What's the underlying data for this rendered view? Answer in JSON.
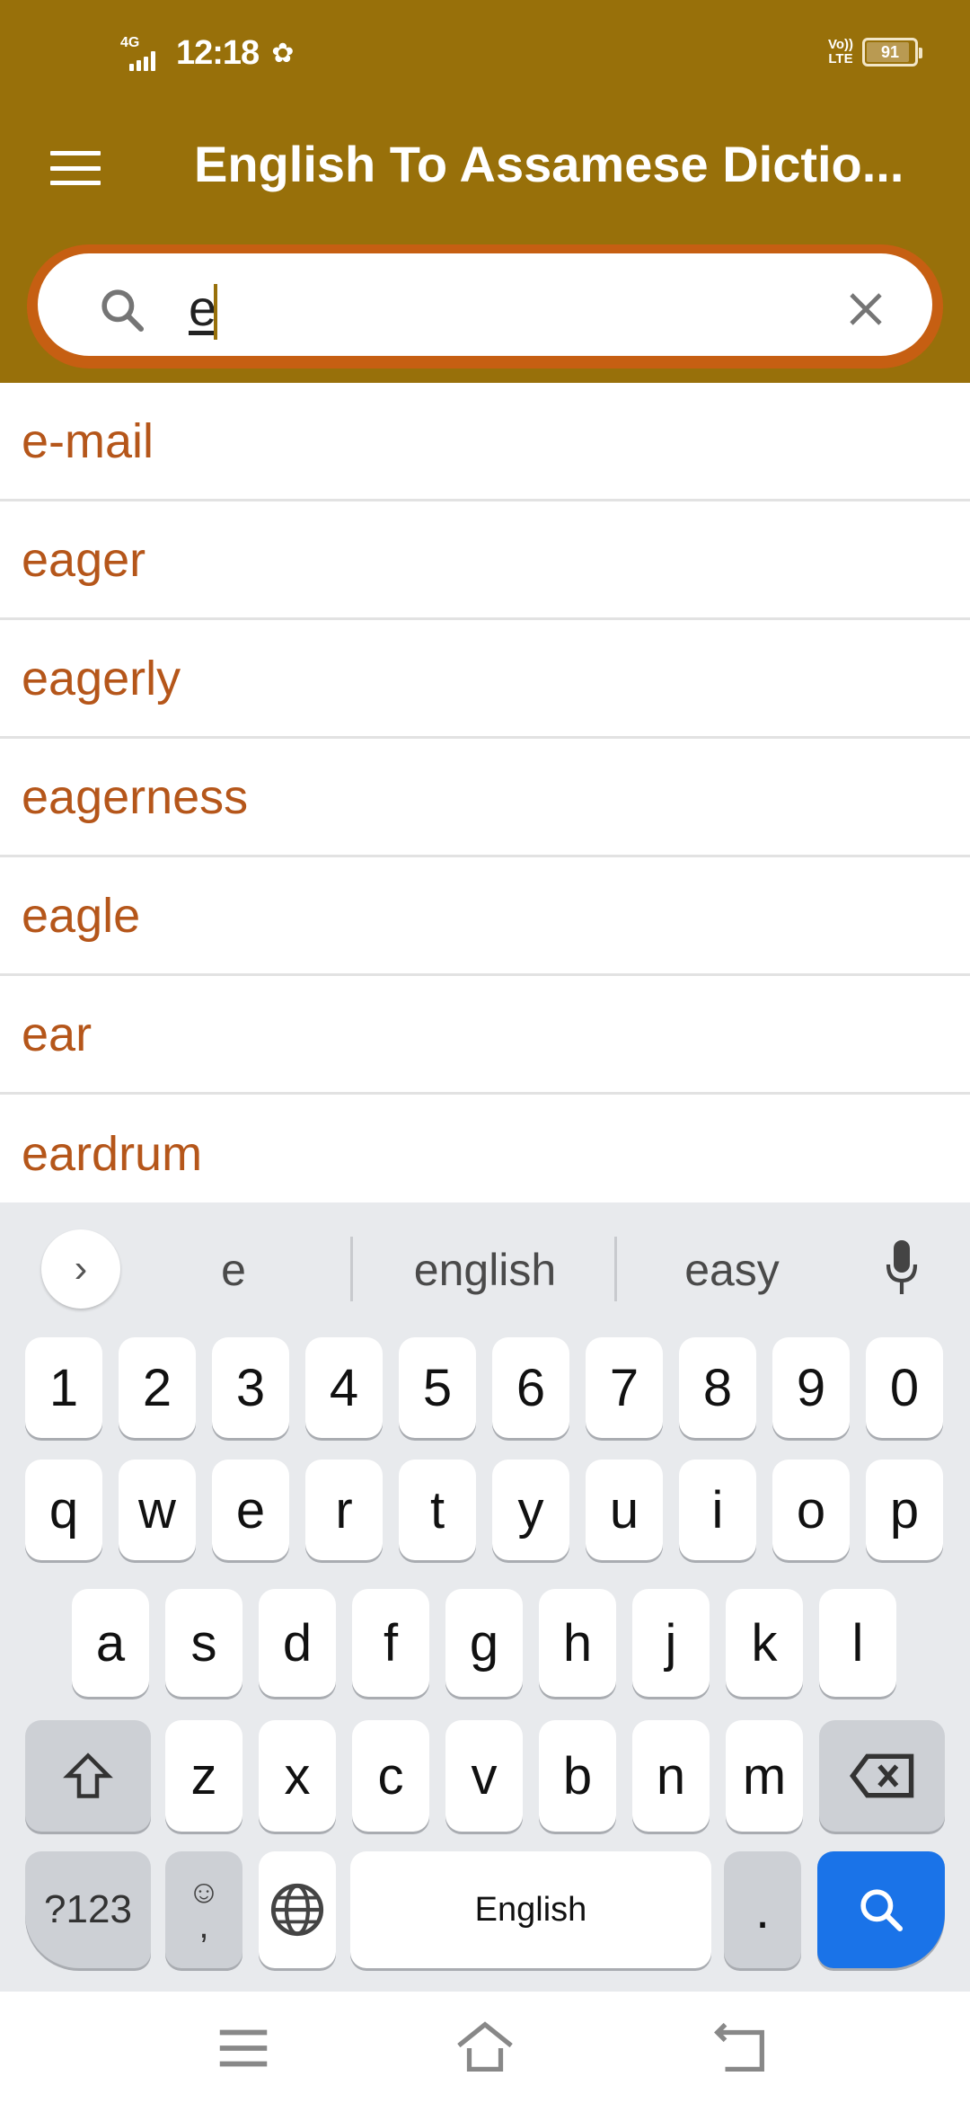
{
  "status_bar": {
    "network": "4G",
    "time": "12:18",
    "volte": [
      "Vo))",
      "LTE"
    ],
    "battery_percent": 91,
    "icons": [
      "signal-icon",
      "settings-gear-icon",
      "volte-icon",
      "battery-icon"
    ]
  },
  "app_bar": {
    "title": "English To Assamese Dictio...",
    "menu_icon": "hamburger-menu-icon"
  },
  "search": {
    "value": "e",
    "search_icon": "search-icon",
    "clear_icon": "close-icon"
  },
  "results": [
    {
      "word": "e-mail"
    },
    {
      "word": "eager"
    },
    {
      "word": "eagerly"
    },
    {
      "word": "eagerness"
    },
    {
      "word": "eagle"
    },
    {
      "word": "ear"
    },
    {
      "word": "eardrum"
    }
  ],
  "keyboard": {
    "suggestions": [
      "e",
      "english",
      "easy"
    ],
    "number_row": [
      "1",
      "2",
      "3",
      "4",
      "5",
      "6",
      "7",
      "8",
      "9",
      "0"
    ],
    "row1": [
      "q",
      "w",
      "e",
      "r",
      "t",
      "y",
      "u",
      "i",
      "o",
      "p"
    ],
    "row2": [
      "a",
      "s",
      "d",
      "f",
      "g",
      "h",
      "j",
      "k",
      "l"
    ],
    "row3": [
      "z",
      "x",
      "c",
      "v",
      "b",
      "n",
      "m"
    ],
    "symbols_label": "?123",
    "comma_label": ",",
    "space_label": "English",
    "period_label": ".",
    "action_color": "#1a73e8"
  },
  "colors": {
    "app_bar": "#98700a",
    "search_border": "#c65f12",
    "result_text": "#b5561a"
  }
}
